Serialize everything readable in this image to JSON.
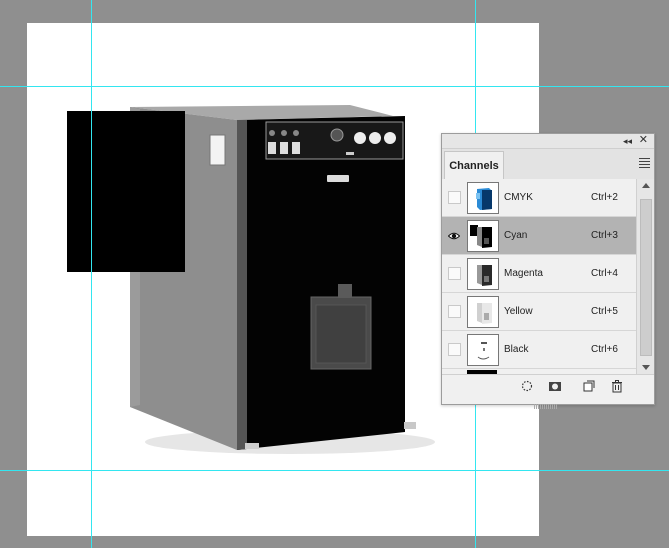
{
  "panel": {
    "title": "Channels",
    "collapse_icon": "double-chevron-icon",
    "close_icon": "close-icon",
    "menu_icon": "hamburger-menu-icon"
  },
  "channels": [
    {
      "name": "CMYK",
      "shortcut": "Ctrl+2",
      "visible": false,
      "selected": false
    },
    {
      "name": "Cyan",
      "shortcut": "Ctrl+3",
      "visible": true,
      "selected": true
    },
    {
      "name": "Magenta",
      "shortcut": "Ctrl+4",
      "visible": false,
      "selected": false
    },
    {
      "name": "Yellow",
      "shortcut": "Ctrl+5",
      "visible": false,
      "selected": false
    },
    {
      "name": "Black",
      "shortcut": "Ctrl+6",
      "visible": false,
      "selected": false
    }
  ],
  "bottom_icons": [
    "selection-circle-icon",
    "mask-icon",
    "new-channel-icon",
    "trash-icon"
  ],
  "colors": {
    "guide": "#33e6f0",
    "pasteboard": "#8f8f8f",
    "selected_row": "#b3b3b3",
    "cmyk_blue": "#2b8bd6"
  }
}
